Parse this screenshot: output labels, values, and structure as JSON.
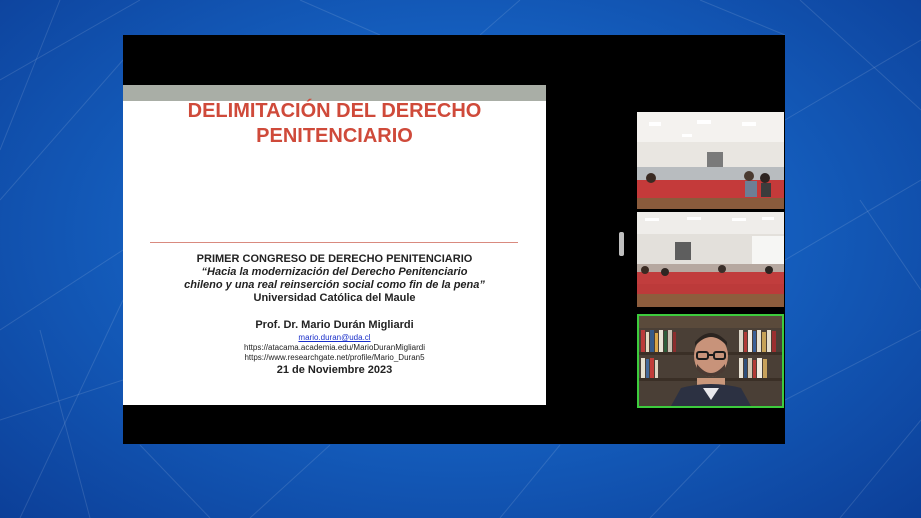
{
  "slide": {
    "title_lines": [
      "DELIMITACIÓN DEL DERECHO",
      "PENITENCIARIO"
    ],
    "congress": "PRIMER CONGRESO DE DERECHO PENITENCIARIO",
    "subtitle_lines": [
      "“Hacia la modernización del Derecho Penitenciario",
      "chileno y una real reinserción social como fin de la pena”"
    ],
    "university": "Universidad Católica del Maule",
    "professor": "Prof. Dr. Mario Durán Migliardi",
    "email": "mario.duran@uda.cl",
    "links": [
      "https://atacama.academia.edu/MarioDuranMigliardi",
      "https://www.researchgate.net/profile/Mario_Duran5"
    ],
    "date": "21 de Noviembre 2023"
  },
  "participants": {
    "tile_1": "auditorium-camera-1",
    "tile_2": "auditorium-camera-2",
    "tile_3": "speaker-camera",
    "active_speaker_color": "#3dcc3d"
  },
  "colors": {
    "title_red": "#cf4a3a",
    "background_blue": "#1560c0"
  }
}
